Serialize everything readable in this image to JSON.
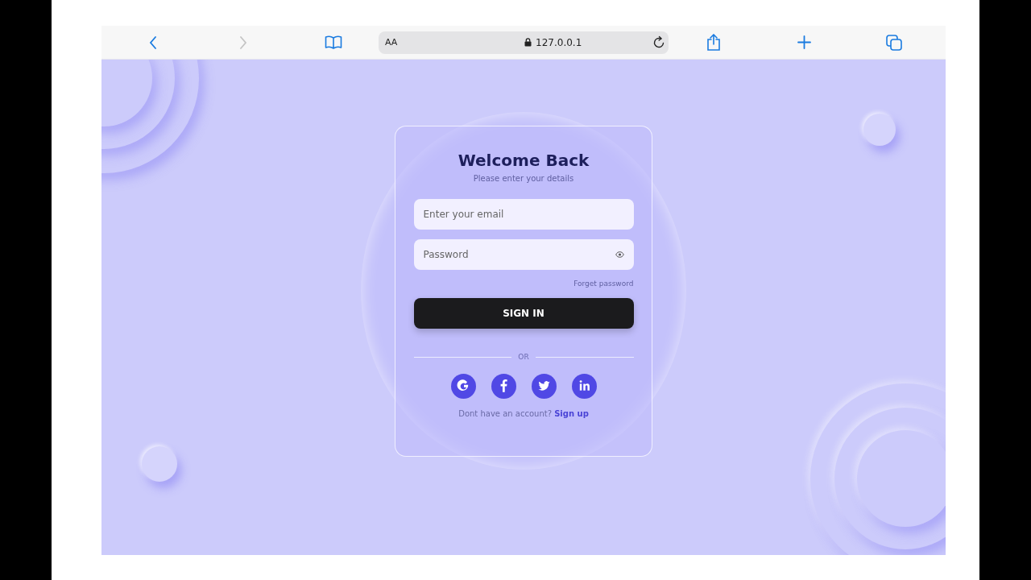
{
  "browser": {
    "nav": [
      {
        "kind": "back",
        "disabled": false
      },
      {
        "kind": "forward",
        "disabled": true
      },
      {
        "kind": "bookmarks",
        "disabled": false
      }
    ],
    "text_size": "AA",
    "url": "127.0.0.1",
    "actions": [
      {
        "kind": "share"
      },
      {
        "kind": "new-tab"
      },
      {
        "kind": "tabs"
      }
    ]
  },
  "login": {
    "title": "Welcome Back",
    "subtitle": "Please enter your details",
    "email": {
      "placeholder": "Enter your email"
    },
    "password": {
      "placeholder": "Password"
    },
    "forgot_link": "Forget password",
    "submit": "SIGN IN",
    "divider": "OR",
    "socials": [
      {
        "kind": "google"
      },
      {
        "kind": "facebook"
      },
      {
        "kind": "twitter"
      },
      {
        "kind": "linkedin"
      }
    ],
    "footer": {
      "text": "Dont have an account?",
      "link": "Sign up"
    }
  }
}
